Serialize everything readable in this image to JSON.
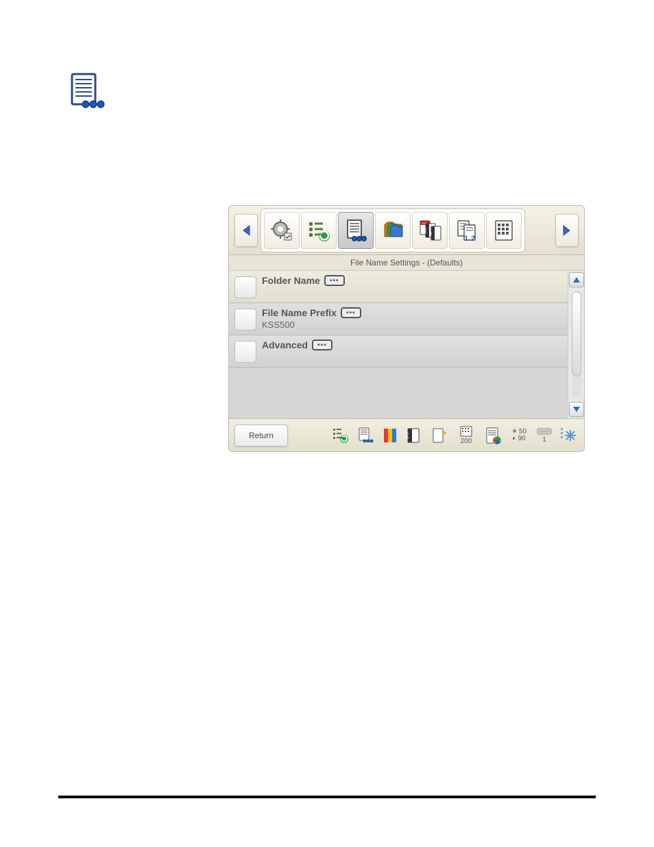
{
  "pageIcon": {
    "name": "file-name-settings-icon"
  },
  "window": {
    "title": "File Name Settings - (Defaults)",
    "toolbar": {
      "navLeft": "◀",
      "navRight": "▶",
      "tools": [
        {
          "name": "settings-gear-icon"
        },
        {
          "name": "list-check-icon"
        },
        {
          "name": "file-name-settings-icon",
          "active": true
        },
        {
          "name": "folder-stack-icon"
        },
        {
          "name": "file-format-icon"
        },
        {
          "name": "file-index-icon"
        },
        {
          "name": "grid-icon"
        }
      ]
    },
    "rows": [
      {
        "label": "Folder Name",
        "value": "",
        "hasMore": true
      },
      {
        "label": "File Name Prefix",
        "value": "KSS500",
        "hasMore": true
      },
      {
        "label": "Advanced",
        "value": "",
        "hasMore": true
      }
    ],
    "footer": {
      "returnLabel": "Return",
      "status": {
        "dpi": "200",
        "brightness": "50",
        "contrast": "90",
        "copies": "1"
      }
    }
  }
}
